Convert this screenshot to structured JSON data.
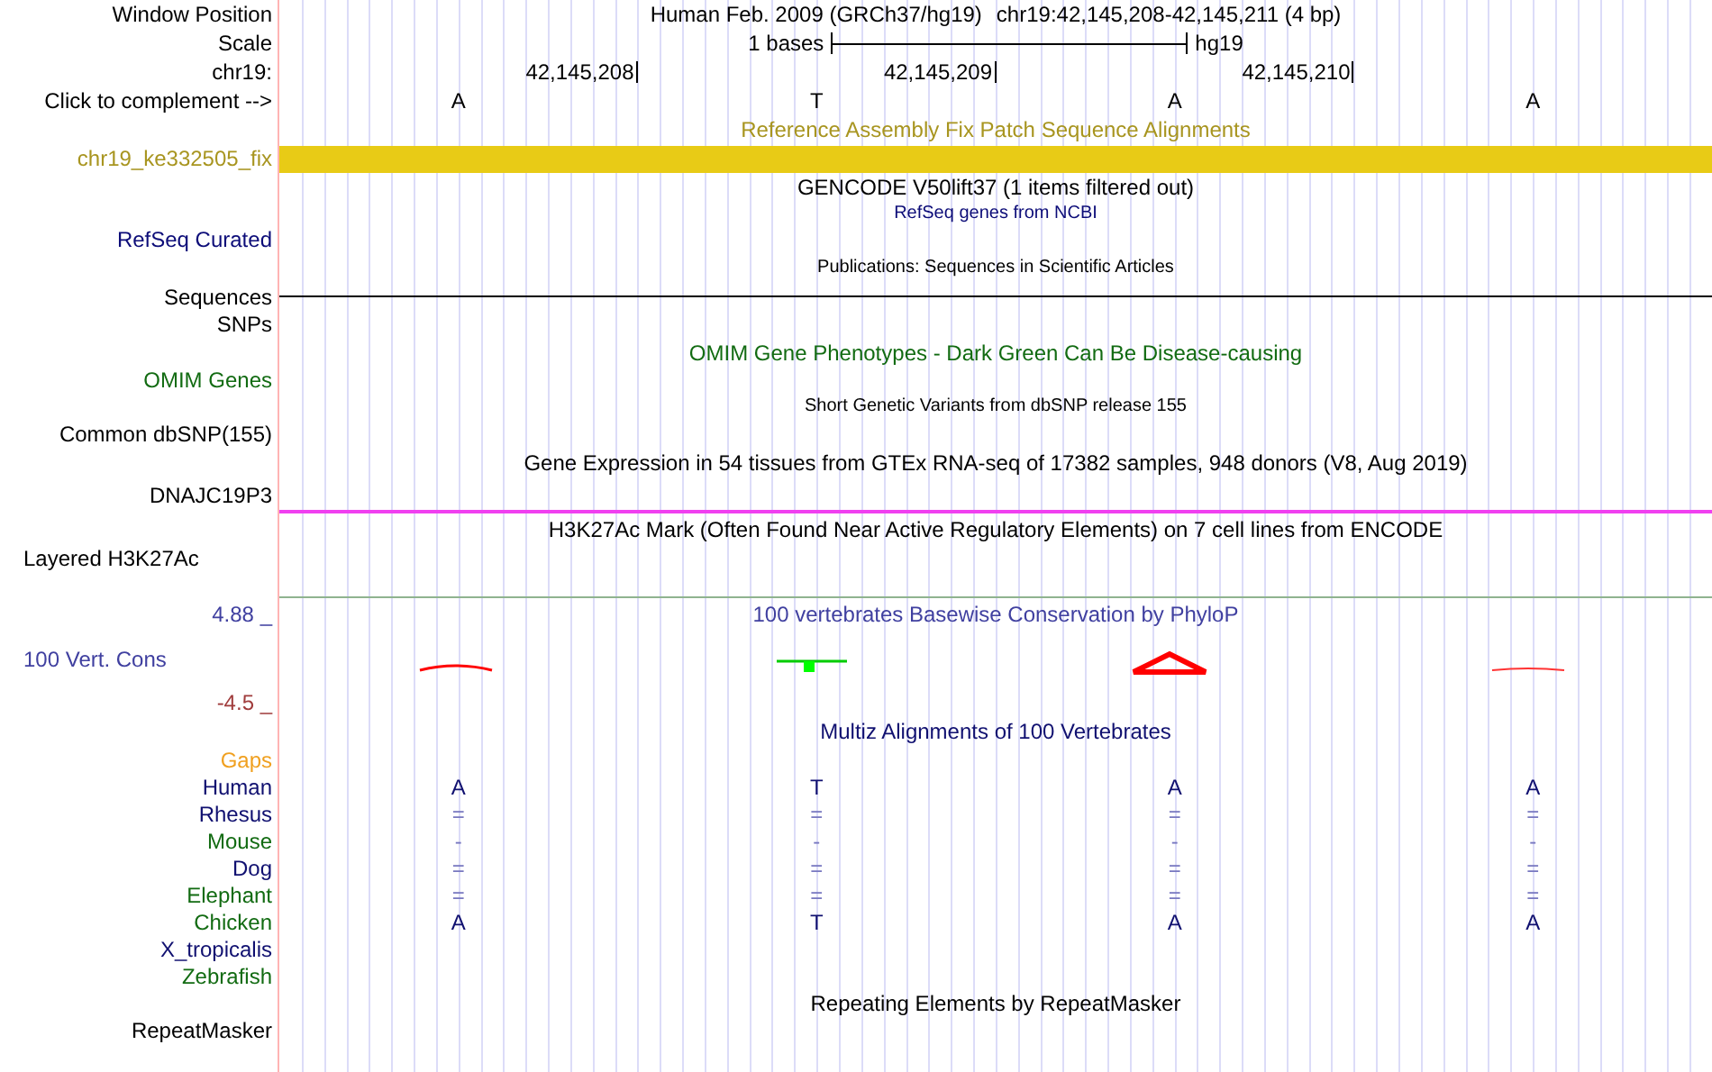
{
  "header": {
    "label": "Window Position",
    "assembly": "Human Feb. 2009 (GRCh37/hg19)",
    "position": "chr19:42,145,208-42,145,211 (4 bp)"
  },
  "scale": {
    "label": "Scale",
    "size": "1 bases",
    "assembly": "hg19"
  },
  "ruler": {
    "label": "chr19:",
    "ticks": [
      "42,145,208",
      "42,145,209",
      "42,145,210"
    ]
  },
  "complement": {
    "label": "Click to complement -->",
    "bases": [
      "A",
      "T",
      "A",
      "A"
    ]
  },
  "tracks": [
    {
      "kind": "bar",
      "title": "Reference Assembly Fix Patch Sequence Alignments",
      "label": "chr19_ke332505_fix",
      "color": "#a89520"
    },
    {
      "kind": "plain",
      "title": "GENCODE V50lift37 (1 items filtered out)",
      "color": "#000000"
    },
    {
      "kind": "plain",
      "group_title": "RefSeq genes from NCBI",
      "label": "RefSeq Curated",
      "color": "#0c0c78"
    },
    {
      "kind": "line",
      "group_title": "Publications: Sequences in Scientific Articles",
      "label": "Sequences",
      "color": "#000000",
      "line": {
        "color": "#000000"
      }
    },
    {
      "kind": "plain",
      "label": "SNPs",
      "color": "#000000"
    },
    {
      "kind": "plain",
      "title": "OMIM Gene Phenotypes - Dark Green Can Be Disease-causing",
      "label": "OMIM Genes",
      "color": "#126b12"
    },
    {
      "kind": "plain",
      "group_title": "Short Genetic Variants from dbSNP release 155",
      "label": "Common dbSNP(155)",
      "color": "#000000"
    },
    {
      "kind": "line",
      "title": "Gene Expression in 54 tissues from GTEx RNA-seq of 17382 samples, 948 donors (V8, Aug 2019)",
      "label": "DNAJC19P3",
      "color": "#000000",
      "line": {
        "color": "#f040f0"
      }
    },
    {
      "kind": "layered",
      "title": "H3K27Ac Mark (Often Found Near Active Regulatory Elements) on 7 cell lines from ENCODE",
      "label": "Layered H3K27Ac",
      "color": "#000000",
      "line": {
        "color": "#8fb38f"
      }
    },
    {
      "kind": "wiggle",
      "title": "100 vertebrates Basewise Conservation by PhyloP",
      "label": "100 Vert. Cons",
      "max_label": "4.88 _",
      "min_label": "-4.5 _",
      "color": "#4040a0"
    },
    {
      "kind": "multiz",
      "title": "Multiz Alignments of 100 Vertebrates",
      "gaps_label": "Gaps",
      "color": "#101070",
      "species": [
        {
          "name": "Human",
          "color": "#101070",
          "kind": "sequence",
          "bases": [
            "A",
            "T",
            "A",
            "A"
          ]
        },
        {
          "name": "Rhesus",
          "color": "#101070",
          "kind": "match",
          "bases": [
            "=",
            "=",
            "=",
            "="
          ]
        },
        {
          "name": "Mouse",
          "color": "#126b12",
          "kind": "match",
          "bases": [
            "-",
            "-",
            "-",
            "-"
          ]
        },
        {
          "name": "Dog",
          "color": "#101070",
          "kind": "match",
          "bases": [
            "=",
            "=",
            "=",
            "="
          ]
        },
        {
          "name": "Elephant",
          "color": "#126b12",
          "kind": "match",
          "bases": [
            "=",
            "=",
            "=",
            "="
          ]
        },
        {
          "name": "Chicken",
          "color": "#126b12",
          "kind": "sequence",
          "bases": [
            "A",
            "T",
            "A",
            "A"
          ]
        },
        {
          "name": "X_tropicalis",
          "color": "#101070"
        },
        {
          "name": "Zebrafish",
          "color": "#126b12"
        }
      ]
    },
    {
      "kind": "plain",
      "title": "Repeating Elements by RepeatMasker",
      "label": "RepeatMasker",
      "color": "#000000"
    }
  ]
}
